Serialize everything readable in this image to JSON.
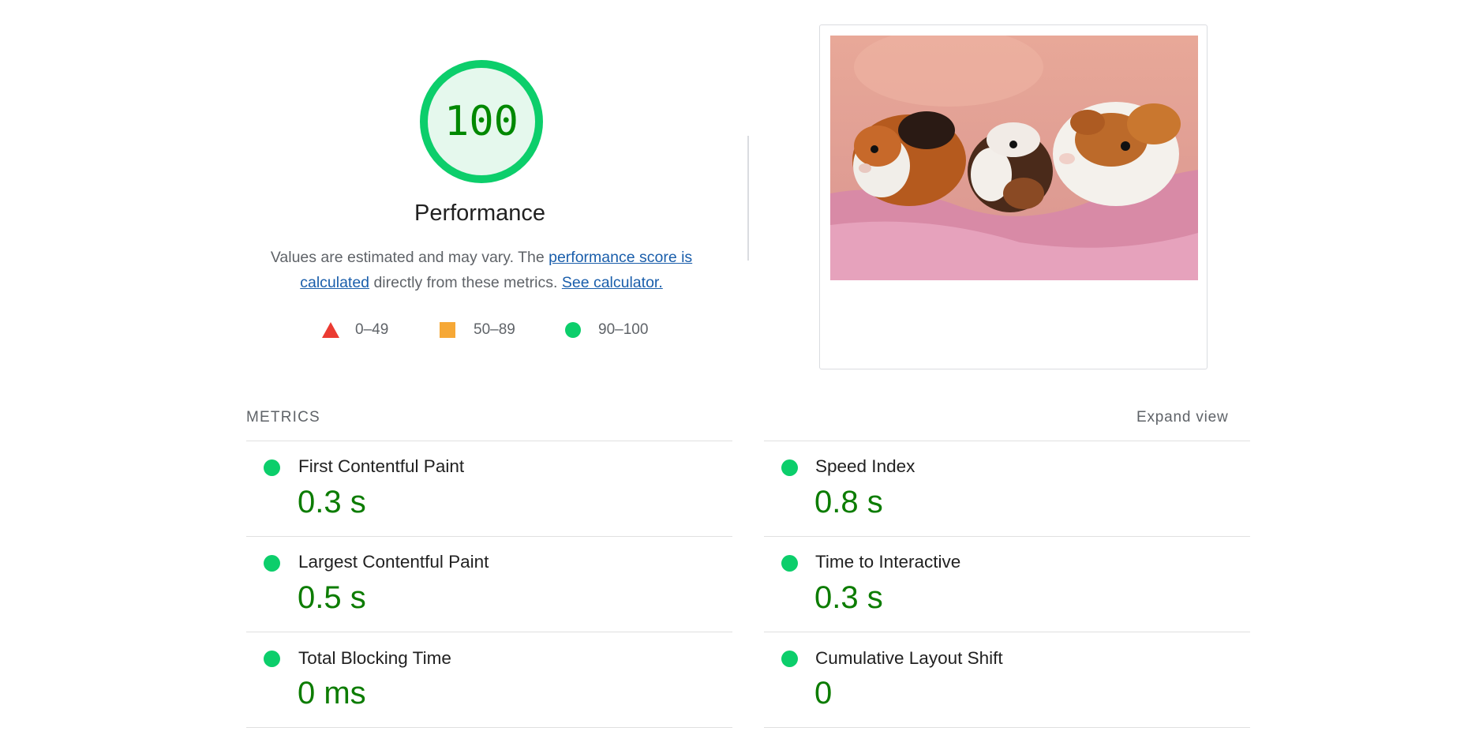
{
  "gauge": {
    "score": "100",
    "title": "Performance"
  },
  "description": {
    "text_before": "Values are estimated and may vary. The ",
    "link1": "performance score is calculated",
    "text_middle": " directly from these metrics. ",
    "link2": "See calculator."
  },
  "legend": [
    {
      "range": "0–49",
      "shape": "triangle-icon",
      "color": "#eb3b32"
    },
    {
      "range": "50–89",
      "shape": "square-icon",
      "color": "#f6a836"
    },
    {
      "range": "90–100",
      "shape": "circle-icon",
      "color": "#0cce6b"
    }
  ],
  "metrics": {
    "header": "METRICS",
    "expand_label": "Expand view",
    "items": [
      {
        "title": "First Contentful Paint",
        "value": "0.3 s"
      },
      {
        "title": "Speed Index",
        "value": "0.8 s"
      },
      {
        "title": "Largest Contentful Paint",
        "value": "0.5 s"
      },
      {
        "title": "Time to Interactive",
        "value": "0.3 s"
      },
      {
        "title": "Total Blocking Time",
        "value": "0 ms"
      },
      {
        "title": "Cumulative Layout Shift",
        "value": "0"
      }
    ]
  },
  "colors": {
    "pass": "#0cce6b",
    "pass_text": "#0c7c00",
    "gauge_fill": "#e5f8ed",
    "link": "#1a5eab"
  }
}
